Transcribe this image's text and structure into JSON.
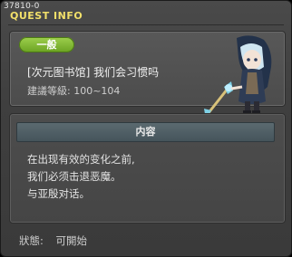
{
  "window": {
    "quest_id": "37810-0",
    "title": "QUEST INFO"
  },
  "quest": {
    "badge": "一般",
    "name": "[次元图书馆] 我们会习惯吗",
    "level_text": "建議等級: 100~104"
  },
  "content": {
    "header": "内容",
    "lines": [
      "在出现有效的变化之前,",
      "我们必须击退恶魔。",
      "与亚殷对话。"
    ]
  },
  "status": {
    "label": "狀態:",
    "value": "可開始"
  },
  "colors": {
    "title": "#f2e06a",
    "badge": "#8cc63f",
    "header": "#52626a"
  }
}
